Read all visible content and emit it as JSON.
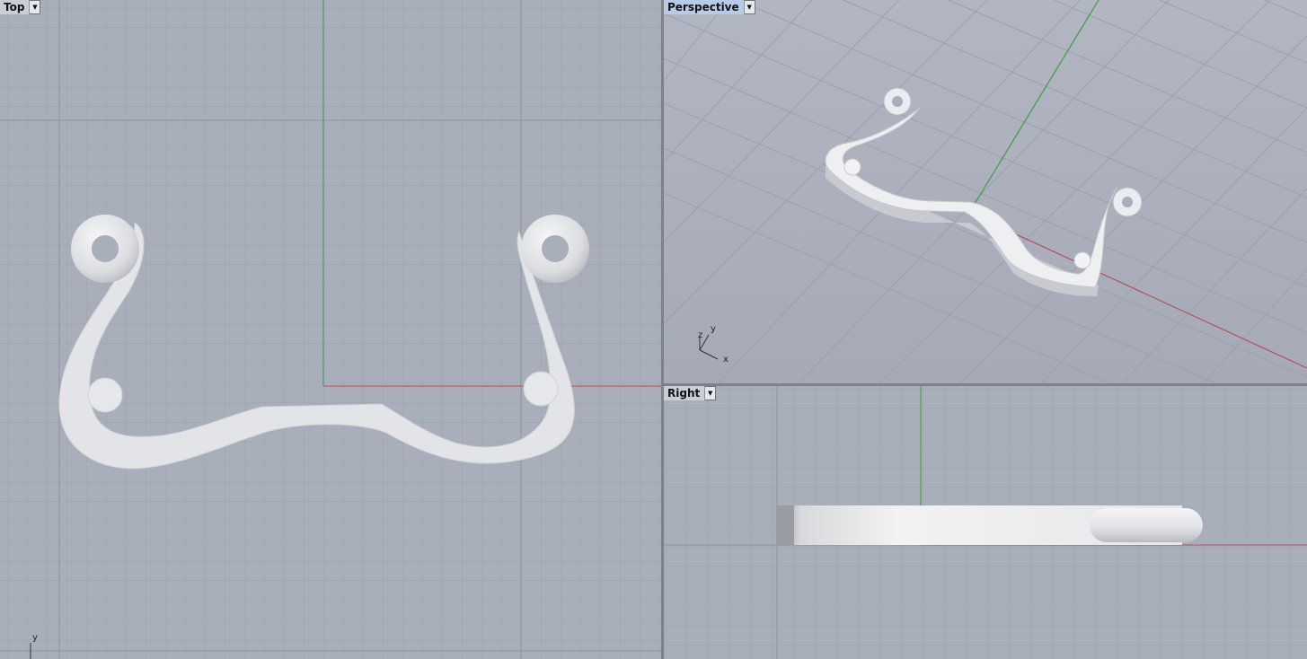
{
  "viewports": {
    "top": {
      "label": "Top",
      "axis_y": "y"
    },
    "perspective": {
      "label": "Perspective",
      "axis_x": "x",
      "axis_y": "y",
      "axis_z": "z"
    },
    "right": {
      "label": "Right"
    }
  },
  "menu_icon": "chevron-down-icon",
  "colors": {
    "background": "#a9aebb",
    "grid_minor": "#9ca1ad",
    "grid_major": "#8d929e",
    "x_axis": "#b3525a",
    "y_axis": "#3d9a45",
    "object": "#e2e3e6",
    "active_label": "#b7cbe6"
  }
}
